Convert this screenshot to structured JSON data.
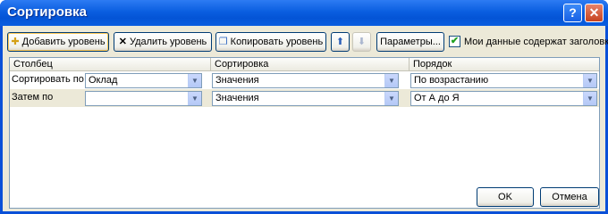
{
  "window": {
    "title": "Сортировка"
  },
  "titlebar": {
    "help_label": "?",
    "close_label": "✕"
  },
  "toolbar": {
    "add_label": "Добавить уровень",
    "delete_label": "Удалить уровень",
    "copy_label": "Копировать уровень",
    "params_label": "Параметры...",
    "headers_checkbox_label": "Мои данные содержат заголовки",
    "headers_checked": true
  },
  "grid": {
    "columns": [
      "Столбец",
      "Сортировка",
      "Порядок"
    ],
    "rows": [
      {
        "label": "Сортировать по",
        "column": "Оклад",
        "sort_on": "Значения",
        "order": "По возрастанию"
      },
      {
        "label": "Затем по",
        "column": "",
        "sort_on": "Значения",
        "order": "От А до Я"
      }
    ]
  },
  "buttons": {
    "ok_label": "OK",
    "cancel_label": "Отмена"
  },
  "colors": {
    "titlebar": "#0a5ee0",
    "dialog_bg": "#ece9d8",
    "combo_border": "#7f9db9"
  }
}
